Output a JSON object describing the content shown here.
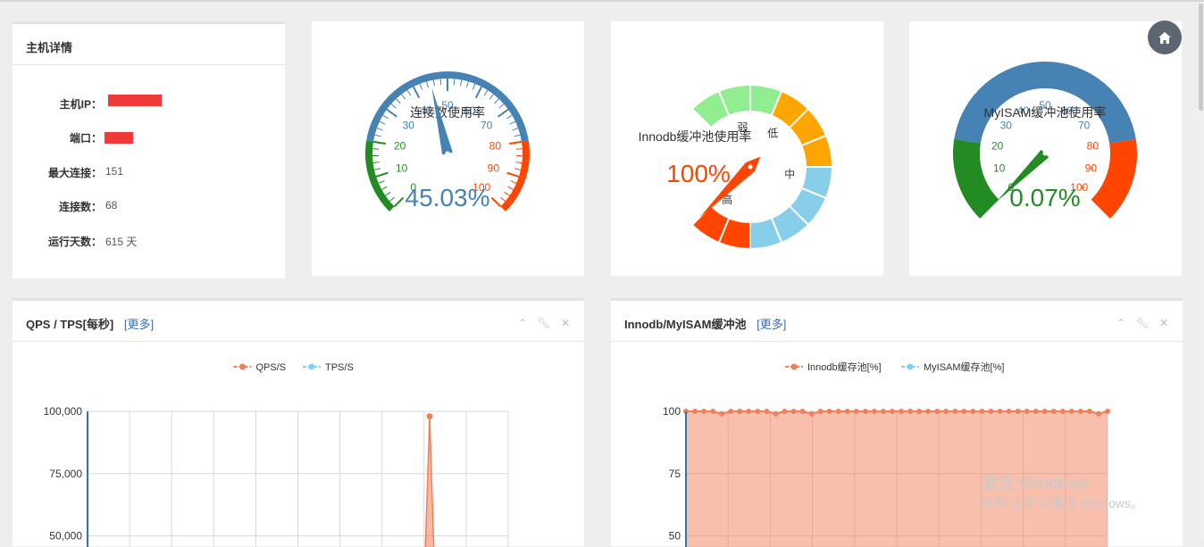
{
  "host": {
    "title": "主机详情",
    "fields": [
      {
        "label": "主机IP：",
        "value": ""
      },
      {
        "label": "端口：",
        "value": ""
      },
      {
        "label": "最大连接：",
        "value": "151"
      },
      {
        "label": "连接数：",
        "value": "68"
      },
      {
        "label": "运行天数：",
        "value": "615 天"
      }
    ]
  },
  "gauges": [
    {
      "title": "连接数使用率",
      "value_text": "45.03%",
      "value": 45.03,
      "ticks": [
        "0",
        "10",
        "20",
        "30",
        "40",
        "50",
        "60",
        "70",
        "80",
        "90",
        "100"
      ],
      "colors": {
        "low": "#228b22",
        "mid": "#4682b4",
        "high": "#ff4500"
      }
    },
    {
      "title": "Innodb缓冲池使用率",
      "value_text": "100%",
      "value": 100,
      "labels": [
        "弱",
        "低",
        "中",
        "高"
      ],
      "colors": {
        "weak": "#90ee90",
        "low": "#ffa500",
        "mid": "#87ceeb",
        "high": "#ff4500"
      }
    },
    {
      "title": "MyISAM缓冲池使用率",
      "value_text": "0.07%",
      "value": 0.07,
      "ticks": [
        "0",
        "10",
        "20",
        "30",
        "40",
        "50",
        "60",
        "70",
        "80",
        "90",
        "100"
      ],
      "colors": {
        "low": "#228b22",
        "mid": "#4682b4",
        "high": "#ff4500"
      }
    }
  ],
  "charts": [
    {
      "title": "QPS / TPS[每秒]",
      "more": "[更多]",
      "chart_data": {
        "type": "line",
        "series": [
          {
            "name": "QPS/S",
            "color": "#f0805a"
          },
          {
            "name": "TPS/S",
            "color": "#87cefa"
          }
        ],
        "y_ticks": [
          "100,000",
          "75,000",
          "50,000"
        ],
        "ylim": [
          0,
          100000
        ],
        "spike_value": 98000
      }
    },
    {
      "title": "Innodb/MyISAM缓冲池",
      "more": "[更多]",
      "chart_data": {
        "type": "area",
        "series": [
          {
            "name": "Innodb缓存池[%]",
            "color": "#f0805a",
            "values": [
              100,
              100,
              100,
              100,
              99,
              100,
              100,
              100,
              100,
              100,
              99,
              100,
              100,
              100,
              99,
              100,
              100,
              100,
              100,
              100,
              100,
              100,
              100,
              100,
              100,
              100,
              100,
              100,
              100,
              100,
              100,
              100,
              100,
              100,
              100,
              100,
              100,
              100,
              100,
              100,
              100,
              100,
              100,
              100,
              100,
              100,
              99,
              100
            ]
          },
          {
            "name": "MyISAM缓存池[%]",
            "color": "#87cefa"
          }
        ],
        "y_ticks": [
          "100",
          "75",
          "50"
        ],
        "ylim": [
          0,
          100
        ]
      }
    }
  ],
  "watermark": {
    "line1": "激活 Windows",
    "line2": "转到“设置”以激活 Windows。"
  },
  "icons": {
    "home": "home-icon",
    "collapse": "chevron-up-icon",
    "settings": "wrench-icon",
    "close": "close-icon"
  }
}
